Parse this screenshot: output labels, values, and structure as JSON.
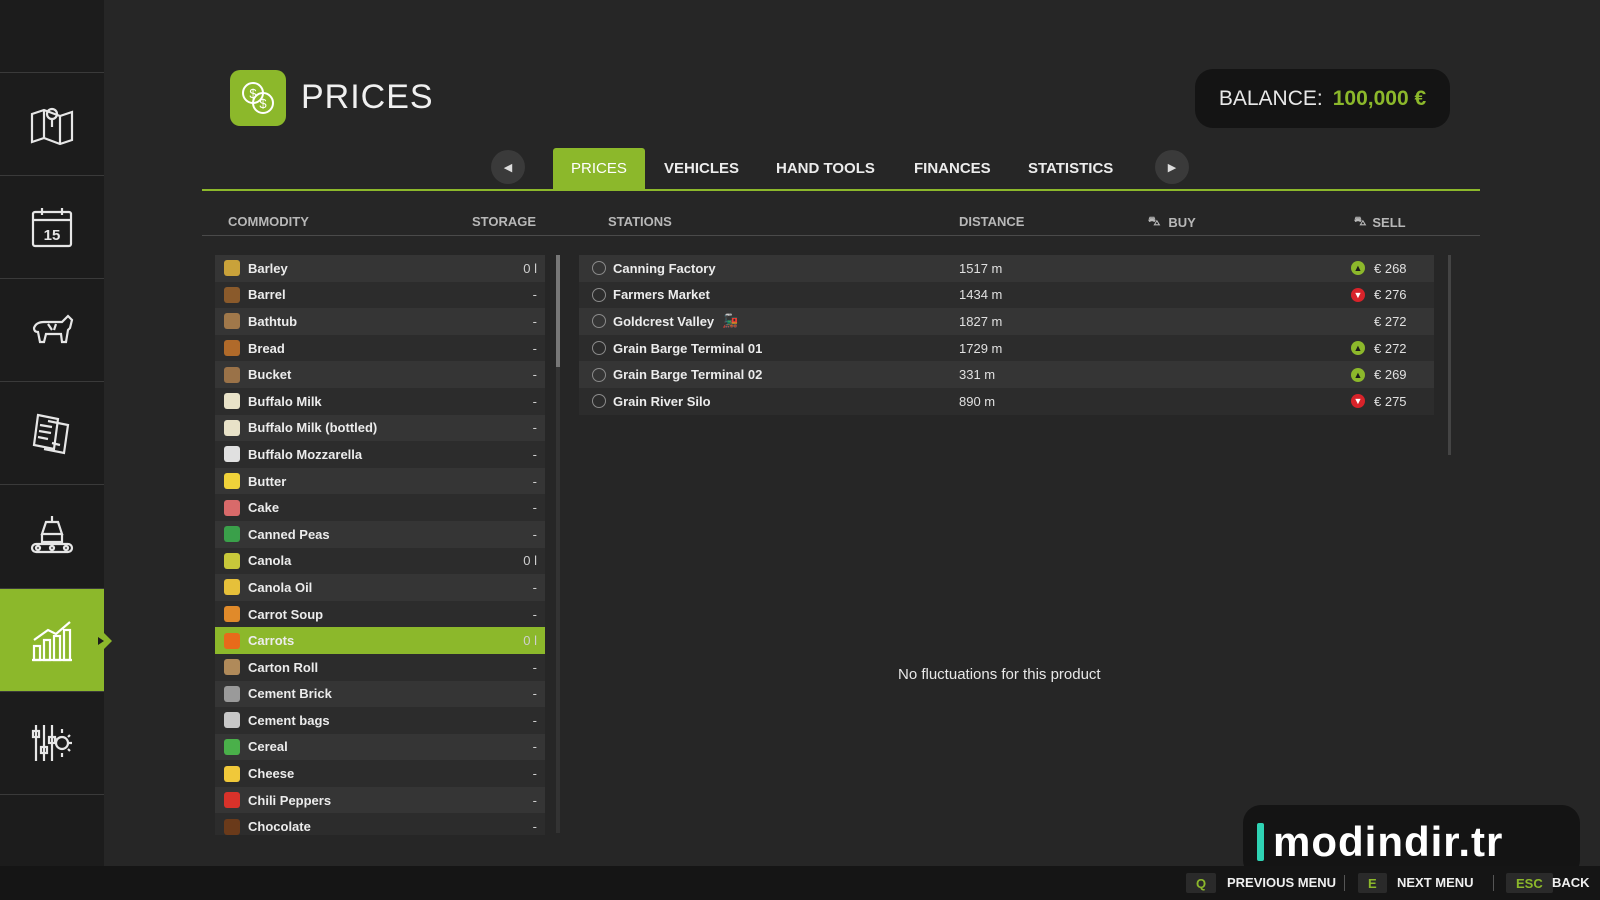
{
  "header": {
    "title": "PRICES",
    "balance_label": "BALANCE:",
    "balance_value": "100,000 €"
  },
  "sidebar": {
    "items": [
      {
        "icon": "map-icon"
      },
      {
        "icon": "calendar-icon",
        "text": "15"
      },
      {
        "icon": "animals-icon"
      },
      {
        "icon": "contracts-icon"
      },
      {
        "icon": "production-icon"
      },
      {
        "icon": "prices-chart-icon",
        "active": true
      },
      {
        "icon": "settings-icon"
      }
    ]
  },
  "tabs": [
    "PRICES",
    "VEHICLES",
    "HAND TOOLS",
    "FINANCES",
    "STATISTICS"
  ],
  "columns": {
    "commodity": "COMMODITY",
    "storage": "STORAGE",
    "stations": "STATIONS",
    "distance": "DISTANCE",
    "buy": "BUY",
    "sell": "SELL"
  },
  "commodities": [
    {
      "name": "Barley",
      "storage": "0 l",
      "color": "#c9a23a"
    },
    {
      "name": "Barrel",
      "storage": "-",
      "color": "#8a5a2b"
    },
    {
      "name": "Bathtub",
      "storage": "-",
      "color": "#a0784a"
    },
    {
      "name": "Bread",
      "storage": "-",
      "color": "#b06a2a"
    },
    {
      "name": "Bucket",
      "storage": "-",
      "color": "#9a7248"
    },
    {
      "name": "Buffalo Milk",
      "storage": "-",
      "color": "#e8e2c8"
    },
    {
      "name": "Buffalo Milk (bottled)",
      "storage": "-",
      "color": "#e8e2c8"
    },
    {
      "name": "Buffalo Mozzarella",
      "storage": "-",
      "color": "#e0e0e0"
    },
    {
      "name": "Butter",
      "storage": "-",
      "color": "#f0d23a"
    },
    {
      "name": "Cake",
      "storage": "-",
      "color": "#d86a6a"
    },
    {
      "name": "Canned Peas",
      "storage": "-",
      "color": "#3aa04a"
    },
    {
      "name": "Canola",
      "storage": "0 l",
      "color": "#c8c83a"
    },
    {
      "name": "Canola Oil",
      "storage": "-",
      "color": "#e6c03a"
    },
    {
      "name": "Carrot Soup",
      "storage": "-",
      "color": "#e08a2a"
    },
    {
      "name": "Carrots",
      "storage": "0 l",
      "color": "#e86a1a",
      "selected": true
    },
    {
      "name": "Carton Roll",
      "storage": "-",
      "color": "#b08a5a"
    },
    {
      "name": "Cement Brick",
      "storage": "-",
      "color": "#9a9a9a"
    },
    {
      "name": "Cement bags",
      "storage": "-",
      "color": "#c8c8c8"
    },
    {
      "name": "Cereal",
      "storage": "-",
      "color": "#4ab04a"
    },
    {
      "name": "Cheese",
      "storage": "-",
      "color": "#f0c83a"
    },
    {
      "name": "Chili Peppers",
      "storage": "-",
      "color": "#d8322a"
    },
    {
      "name": "Chocolate",
      "storage": "-",
      "color": "#6a3a1a"
    }
  ],
  "stations": [
    {
      "name": "Canning Factory",
      "distance": "1517 m",
      "trend": "up",
      "sell": "€ 268"
    },
    {
      "name": "Farmers Market",
      "distance": "1434 m",
      "trend": "down",
      "sell": "€ 276"
    },
    {
      "name": "Goldcrest Valley",
      "distance": "1827 m",
      "trend": "none",
      "sell": "€ 272",
      "train": true
    },
    {
      "name": "Grain Barge Terminal 01",
      "distance": "1729 m",
      "trend": "up",
      "sell": "€ 272"
    },
    {
      "name": "Grain Barge Terminal 02",
      "distance": "331 m",
      "trend": "up",
      "sell": "€ 269"
    },
    {
      "name": "Grain River Silo",
      "distance": "890 m",
      "trend": "down",
      "sell": "€ 275"
    }
  ],
  "empty_message": "No fluctuations for this product",
  "watermark": "modindir.tr",
  "footer": [
    {
      "key": "Q",
      "label": "PREVIOUS MENU"
    },
    {
      "key": "E",
      "label": "NEXT MENU"
    },
    {
      "key": "ESC",
      "label": "BACK"
    }
  ],
  "colors": {
    "accent": "#8cb82b",
    "up": "#8cb82b",
    "down": "#d8232a"
  }
}
